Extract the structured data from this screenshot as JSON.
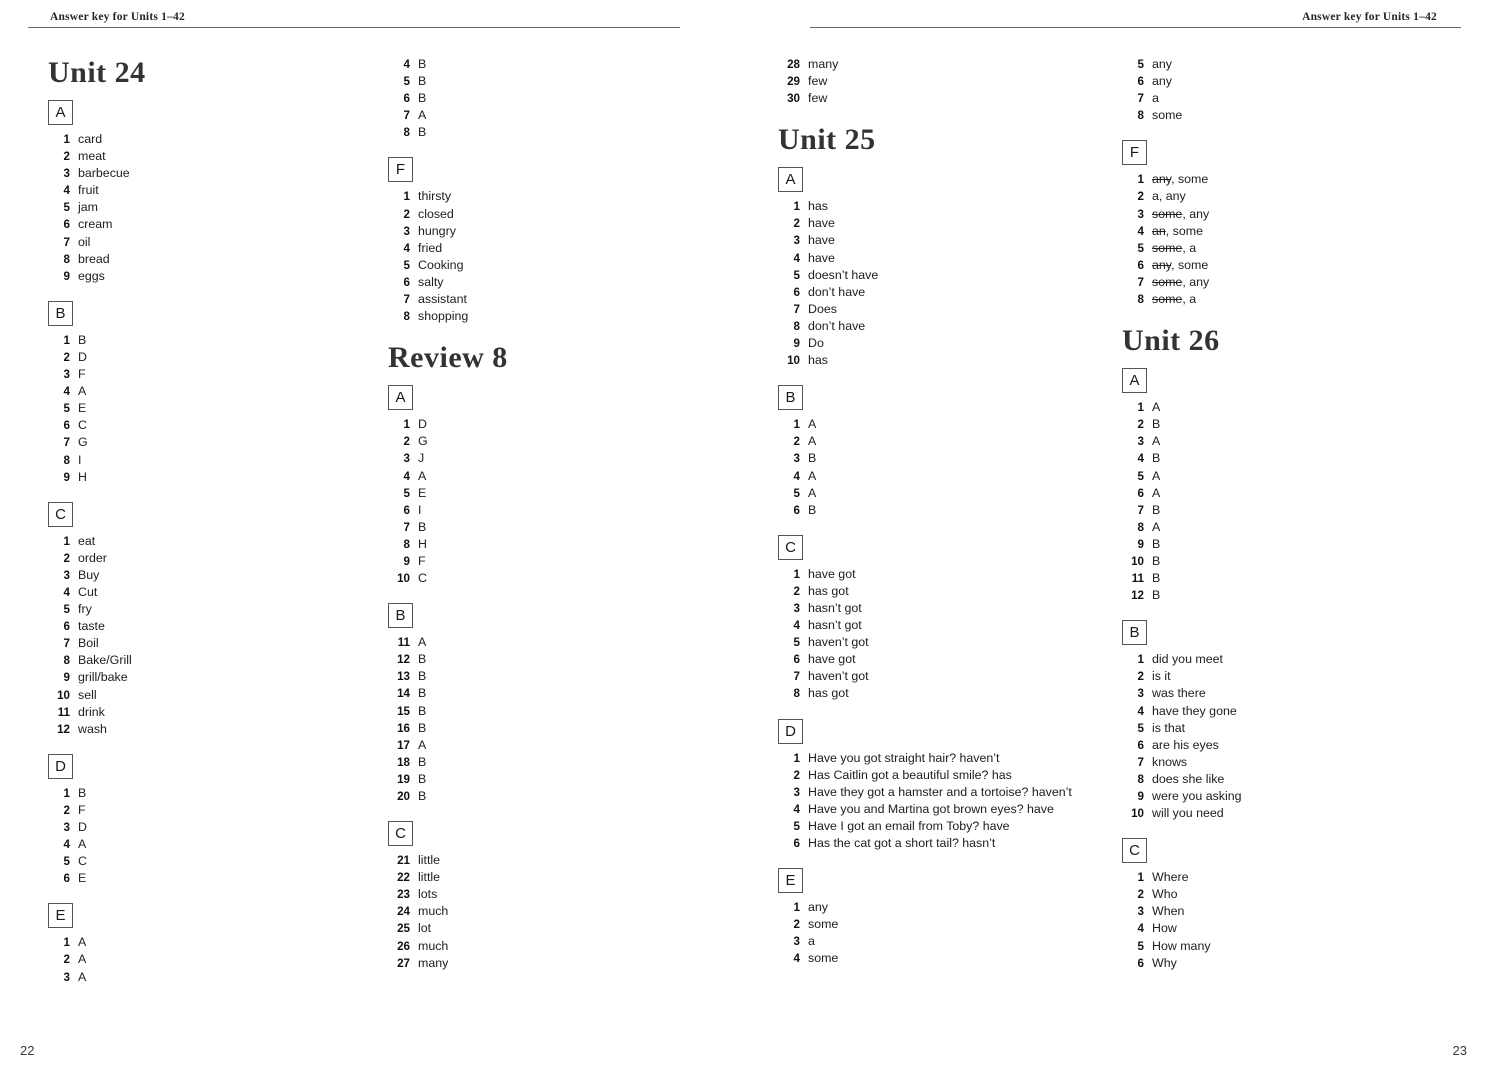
{
  "header": {
    "running_head_left": "Answer key for Units 1–42",
    "running_head_right": "Answer key for Units 1–42"
  },
  "footer": {
    "folio_left": "22",
    "folio_right": "23"
  },
  "columns": [
    {
      "name": "column-1",
      "blocks": [
        {
          "type": "unit-title",
          "title": "Unit 24"
        },
        {
          "type": "exercise",
          "letter": "A",
          "items": [
            {
              "num": "1",
              "text": "card"
            },
            {
              "num": "2",
              "text": "meat"
            },
            {
              "num": "3",
              "text": "barbecue"
            },
            {
              "num": "4",
              "text": "fruit"
            },
            {
              "num": "5",
              "text": "jam"
            },
            {
              "num": "6",
              "text": "cream"
            },
            {
              "num": "7",
              "text": "oil"
            },
            {
              "num": "8",
              "text": "bread"
            },
            {
              "num": "9",
              "text": "eggs"
            }
          ]
        },
        {
          "type": "exercise",
          "letter": "B",
          "items": [
            {
              "num": "1",
              "text": "B"
            },
            {
              "num": "2",
              "text": "D"
            },
            {
              "num": "3",
              "text": "F"
            },
            {
              "num": "4",
              "text": "A"
            },
            {
              "num": "5",
              "text": "E"
            },
            {
              "num": "6",
              "text": "C"
            },
            {
              "num": "7",
              "text": "G"
            },
            {
              "num": "8",
              "text": "I"
            },
            {
              "num": "9",
              "text": "H"
            }
          ]
        },
        {
          "type": "exercise",
          "letter": "C",
          "items": [
            {
              "num": "1",
              "text": "eat"
            },
            {
              "num": "2",
              "text": "order"
            },
            {
              "num": "3",
              "text": "Buy"
            },
            {
              "num": "4",
              "text": "Cut"
            },
            {
              "num": "5",
              "text": "fry"
            },
            {
              "num": "6",
              "text": "taste"
            },
            {
              "num": "7",
              "text": "Boil"
            },
            {
              "num": "8",
              "text": "Bake/Grill"
            },
            {
              "num": "9",
              "text": "grill/bake"
            },
            {
              "num": "10",
              "text": "sell"
            },
            {
              "num": "11",
              "text": "drink"
            },
            {
              "num": "12",
              "text": "wash"
            }
          ]
        },
        {
          "type": "exercise",
          "letter": "D",
          "items": [
            {
              "num": "1",
              "text": "B"
            },
            {
              "num": "2",
              "text": "F"
            },
            {
              "num": "3",
              "text": "D"
            },
            {
              "num": "4",
              "text": "A"
            },
            {
              "num": "5",
              "text": "C"
            },
            {
              "num": "6",
              "text": "E"
            }
          ]
        },
        {
          "type": "exercise",
          "letter": "E",
          "items": [
            {
              "num": "1",
              "text": "A"
            },
            {
              "num": "2",
              "text": "A"
            },
            {
              "num": "3",
              "text": "A"
            }
          ]
        }
      ]
    },
    {
      "name": "column-2",
      "blocks": [
        {
          "type": "continuation",
          "items": [
            {
              "num": "4",
              "text": "B"
            },
            {
              "num": "5",
              "text": "B"
            },
            {
              "num": "6",
              "text": "B"
            },
            {
              "num": "7",
              "text": "A"
            },
            {
              "num": "8",
              "text": "B"
            }
          ]
        },
        {
          "type": "exercise",
          "letter": "F",
          "items": [
            {
              "num": "1",
              "text": "thirsty"
            },
            {
              "num": "2",
              "text": "closed"
            },
            {
              "num": "3",
              "text": "hungry"
            },
            {
              "num": "4",
              "text": "fried"
            },
            {
              "num": "5",
              "text": "Cooking"
            },
            {
              "num": "6",
              "text": "salty"
            },
            {
              "num": "7",
              "text": "assistant"
            },
            {
              "num": "8",
              "text": "shopping"
            }
          ]
        },
        {
          "type": "unit-title",
          "title": "Review 8"
        },
        {
          "type": "exercise",
          "letter": "A",
          "items": [
            {
              "num": "1",
              "text": "D"
            },
            {
              "num": "2",
              "text": "G"
            },
            {
              "num": "3",
              "text": "J"
            },
            {
              "num": "4",
              "text": "A"
            },
            {
              "num": "5",
              "text": "E"
            },
            {
              "num": "6",
              "text": "I"
            },
            {
              "num": "7",
              "text": "B"
            },
            {
              "num": "8",
              "text": "H"
            },
            {
              "num": "9",
              "text": "F"
            },
            {
              "num": "10",
              "text": "C"
            }
          ]
        },
        {
          "type": "exercise",
          "letter": "B",
          "items": [
            {
              "num": "11",
              "text": "A"
            },
            {
              "num": "12",
              "text": "B"
            },
            {
              "num": "13",
              "text": "B"
            },
            {
              "num": "14",
              "text": "B"
            },
            {
              "num": "15",
              "text": "B"
            },
            {
              "num": "16",
              "text": "B"
            },
            {
              "num": "17",
              "text": "A"
            },
            {
              "num": "18",
              "text": "B"
            },
            {
              "num": "19",
              "text": "B"
            },
            {
              "num": "20",
              "text": "B"
            }
          ]
        },
        {
          "type": "exercise",
          "letter": "C",
          "items": [
            {
              "num": "21",
              "text": "little"
            },
            {
              "num": "22",
              "text": "little"
            },
            {
              "num": "23",
              "text": "lots"
            },
            {
              "num": "24",
              "text": "much"
            },
            {
              "num": "25",
              "text": "lot"
            },
            {
              "num": "26",
              "text": "much"
            },
            {
              "num": "27",
              "text": "many"
            }
          ]
        }
      ]
    },
    {
      "name": "column-3",
      "blocks": [
        {
          "type": "continuation",
          "items": [
            {
              "num": "28",
              "text": "many"
            },
            {
              "num": "29",
              "text": "few"
            },
            {
              "num": "30",
              "text": "few"
            }
          ]
        },
        {
          "type": "unit-title",
          "title": "Unit 25"
        },
        {
          "type": "exercise",
          "letter": "A",
          "items": [
            {
              "num": "1",
              "text": "has"
            },
            {
              "num": "2",
              "text": "have"
            },
            {
              "num": "3",
              "text": "have"
            },
            {
              "num": "4",
              "text": "have"
            },
            {
              "num": "5",
              "text": "doesn’t have"
            },
            {
              "num": "6",
              "text": "don’t have"
            },
            {
              "num": "7",
              "text": "Does"
            },
            {
              "num": "8",
              "text": "don’t have"
            },
            {
              "num": "9",
              "text": "Do"
            },
            {
              "num": "10",
              "text": "has"
            }
          ]
        },
        {
          "type": "exercise",
          "letter": "B",
          "items": [
            {
              "num": "1",
              "text": "A"
            },
            {
              "num": "2",
              "text": "A"
            },
            {
              "num": "3",
              "text": "B"
            },
            {
              "num": "4",
              "text": "A"
            },
            {
              "num": "5",
              "text": "A"
            },
            {
              "num": "6",
              "text": "B"
            }
          ]
        },
        {
          "type": "exercise",
          "letter": "C",
          "items": [
            {
              "num": "1",
              "text": "have got"
            },
            {
              "num": "2",
              "text": "has got"
            },
            {
              "num": "3",
              "text": "hasn’t got"
            },
            {
              "num": "4",
              "text": "hasn’t got"
            },
            {
              "num": "5",
              "text": "haven’t got"
            },
            {
              "num": "6",
              "text": "have got"
            },
            {
              "num": "7",
              "text": "haven’t got"
            },
            {
              "num": "8",
              "text": "has got"
            }
          ]
        },
        {
          "type": "exercise",
          "letter": "D",
          "long": true,
          "items": [
            {
              "num": "1",
              "text": "Have you got straight hair? haven’t"
            },
            {
              "num": "2",
              "text": "Has Caitlin got a beautiful smile? has"
            },
            {
              "num": "3",
              "text": "Have they got a hamster and a tortoise? haven’t"
            },
            {
              "num": "4",
              "text": "Have you and Martina got brown eyes? have"
            },
            {
              "num": "5",
              "text": "Have I got an email from Toby? have"
            },
            {
              "num": "6",
              "text": "Has the cat got a short tail? hasn’t"
            }
          ]
        },
        {
          "type": "exercise",
          "letter": "E",
          "items": [
            {
              "num": "1",
              "text": "any"
            },
            {
              "num": "2",
              "text": "some"
            },
            {
              "num": "3",
              "text": "a"
            },
            {
              "num": "4",
              "text": "some"
            }
          ]
        }
      ]
    },
    {
      "name": "column-4",
      "blocks": [
        {
          "type": "continuation",
          "items": [
            {
              "num": "5",
              "text": "any"
            },
            {
              "num": "6",
              "text": "any"
            },
            {
              "num": "7",
              "text": "a"
            },
            {
              "num": "8",
              "text": "some"
            }
          ]
        },
        {
          "type": "exercise",
          "letter": "F",
          "items": [
            {
              "num": "1",
              "struck": "any",
              "text": ", some"
            },
            {
              "num": "2",
              "text": "a, any"
            },
            {
              "num": "3",
              "struck": "some",
              "text": ", any"
            },
            {
              "num": "4",
              "struck": "an",
              "text": ", some"
            },
            {
              "num": "5",
              "struck": "some",
              "text": ", a"
            },
            {
              "num": "6",
              "struck": "any",
              "text": ", some"
            },
            {
              "num": "7",
              "struck": "some",
              "text": ", any"
            },
            {
              "num": "8",
              "struck": "some",
              "text": ", a"
            }
          ]
        },
        {
          "type": "unit-title",
          "title": "Unit 26"
        },
        {
          "type": "exercise",
          "letter": "A",
          "items": [
            {
              "num": "1",
              "text": "A"
            },
            {
              "num": "2",
              "text": "B"
            },
            {
              "num": "3",
              "text": "A"
            },
            {
              "num": "4",
              "text": "B"
            },
            {
              "num": "5",
              "text": "A"
            },
            {
              "num": "6",
              "text": "A"
            },
            {
              "num": "7",
              "text": "B"
            },
            {
              "num": "8",
              "text": "A"
            },
            {
              "num": "9",
              "text": "B"
            },
            {
              "num": "10",
              "text": "B"
            },
            {
              "num": "11",
              "text": "B"
            },
            {
              "num": "12",
              "text": "B"
            }
          ]
        },
        {
          "type": "exercise",
          "letter": "B",
          "items": [
            {
              "num": "1",
              "text": "did you meet"
            },
            {
              "num": "2",
              "text": "is it"
            },
            {
              "num": "3",
              "text": "was there"
            },
            {
              "num": "4",
              "text": "have they gone"
            },
            {
              "num": "5",
              "text": "is that"
            },
            {
              "num": "6",
              "text": "are his eyes"
            },
            {
              "num": "7",
              "text": "knows"
            },
            {
              "num": "8",
              "text": "does she like"
            },
            {
              "num": "9",
              "text": "were you asking"
            },
            {
              "num": "10",
              "text": "will you need"
            }
          ]
        },
        {
          "type": "exercise",
          "letter": "C",
          "items": [
            {
              "num": "1",
              "text": "Where"
            },
            {
              "num": "2",
              "text": "Who"
            },
            {
              "num": "3",
              "text": "When"
            },
            {
              "num": "4",
              "text": "How"
            },
            {
              "num": "5",
              "text": "How many"
            },
            {
              "num": "6",
              "text": "Why"
            }
          ]
        }
      ]
    }
  ]
}
